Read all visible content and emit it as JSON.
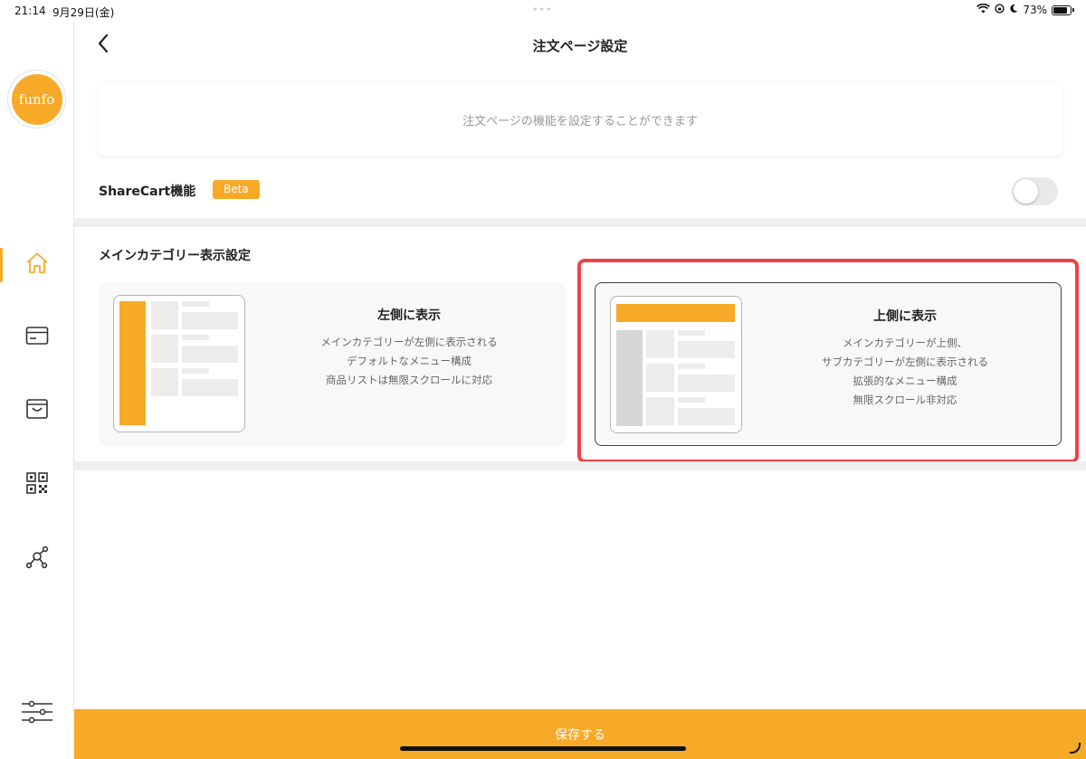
{
  "status_bar": {
    "time": "21:14",
    "date": "9月29日(金)",
    "battery": "73%",
    "battery_level": 0.73
  },
  "sidebar": {
    "logo_text": "funfo",
    "items": [
      {
        "name": "home",
        "icon": "home-icon",
        "active": true
      },
      {
        "name": "card",
        "icon": "card-icon",
        "active": false
      },
      {
        "name": "shop",
        "icon": "shopping-bag-icon",
        "active": false
      },
      {
        "name": "qr",
        "icon": "qr-code-icon",
        "active": false
      },
      {
        "name": "network",
        "icon": "network-icon",
        "active": false
      }
    ],
    "settings_icon": "sliders-icon"
  },
  "header": {
    "title": "注文ページ設定",
    "back_icon": "chevron-left-icon"
  },
  "info": {
    "text": "注文ページの機能を設定することができます"
  },
  "sharecart": {
    "label": "ShareCart機能",
    "badge": "Beta",
    "enabled": false
  },
  "category_settings": {
    "title": "メインカテゴリー表示設定",
    "options": [
      {
        "title": "左側に表示",
        "lines": [
          "メインカテゴリーが左側に表示される",
          "デフォルトなメニュー構成",
          "商品リストは無限スクロールに対応"
        ],
        "selected": false
      },
      {
        "title": "上側に表示",
        "lines": [
          "メインカテゴリーが上側、",
          "サブカテゴリーが左側に表示される",
          "拡張的なメニュー構成",
          "無限スクロール非対応"
        ],
        "selected": true
      }
    ]
  },
  "save": {
    "label": "保存する"
  },
  "colors": {
    "accent": "#f7a928",
    "highlight": "#f0414a"
  }
}
